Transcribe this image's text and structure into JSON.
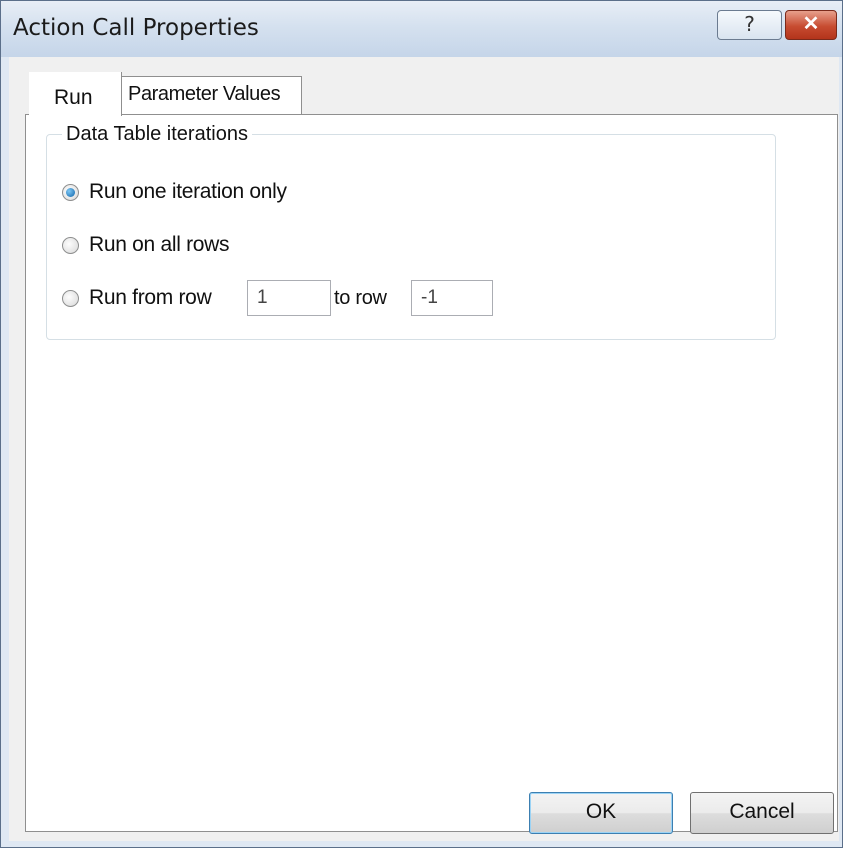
{
  "window": {
    "title": "Action Call Properties",
    "help_label": "?",
    "close_label": "✕"
  },
  "tabs": [
    {
      "label": "Run"
    },
    {
      "label": "Parameter Values"
    }
  ],
  "group": {
    "label": "Data Table iterations",
    "options": [
      {
        "label": "Run one iteration only",
        "checked": true
      },
      {
        "label": "Run on all rows",
        "checked": false
      },
      {
        "label": "Run from row",
        "checked": false
      }
    ],
    "from_row": "1",
    "to_label": "to row",
    "to_row": "-1"
  },
  "buttons": {
    "ok": "OK",
    "cancel": "Cancel"
  }
}
